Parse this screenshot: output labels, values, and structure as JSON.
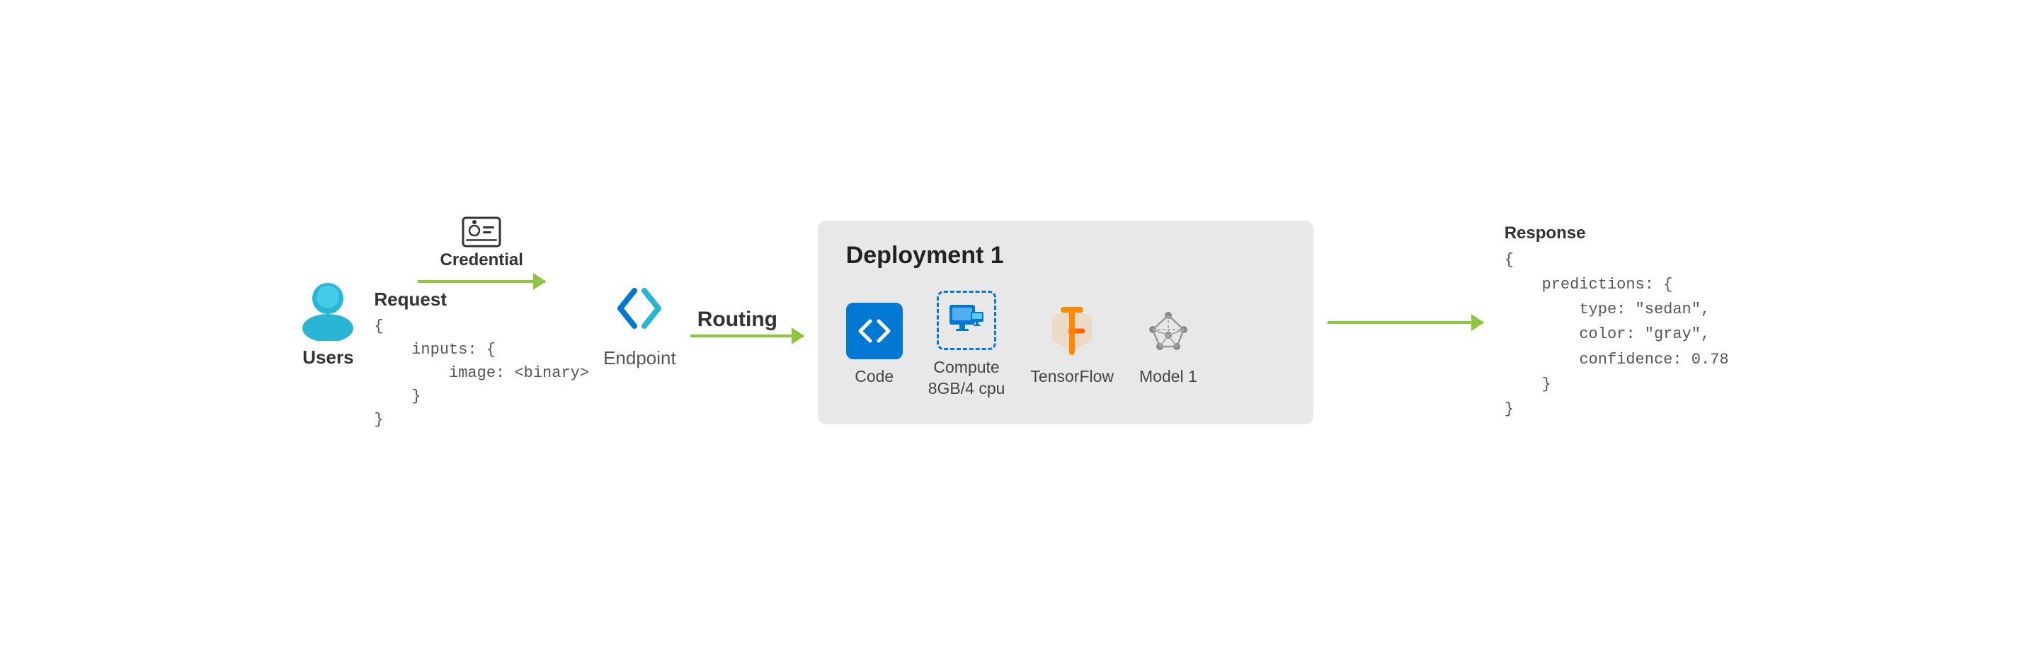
{
  "diagram": {
    "user": {
      "label": "Users",
      "icon": "user-icon"
    },
    "credential_label": "Credential",
    "arrow1_label": "Request",
    "request_code": "{\n    inputs: {\n        image: <binary>\n    }\n}",
    "endpoint": {
      "label": "Endpoint",
      "icon": "endpoint-icon"
    },
    "routing_label": "Routing",
    "deployment": {
      "title": "Deployment 1",
      "items": [
        {
          "id": "code",
          "label": "Code"
        },
        {
          "id": "compute",
          "label": "Compute\n8GB/4 cpu"
        },
        {
          "id": "tensorflow",
          "label": "TensorFlow"
        },
        {
          "id": "model1",
          "label": "Model 1"
        }
      ]
    },
    "response_label": "Response",
    "response_code": "{\n    predictions: {\n        type: \"sedan\",\n        color: \"gray\",\n        confidence: 0.78\n    }\n}"
  }
}
